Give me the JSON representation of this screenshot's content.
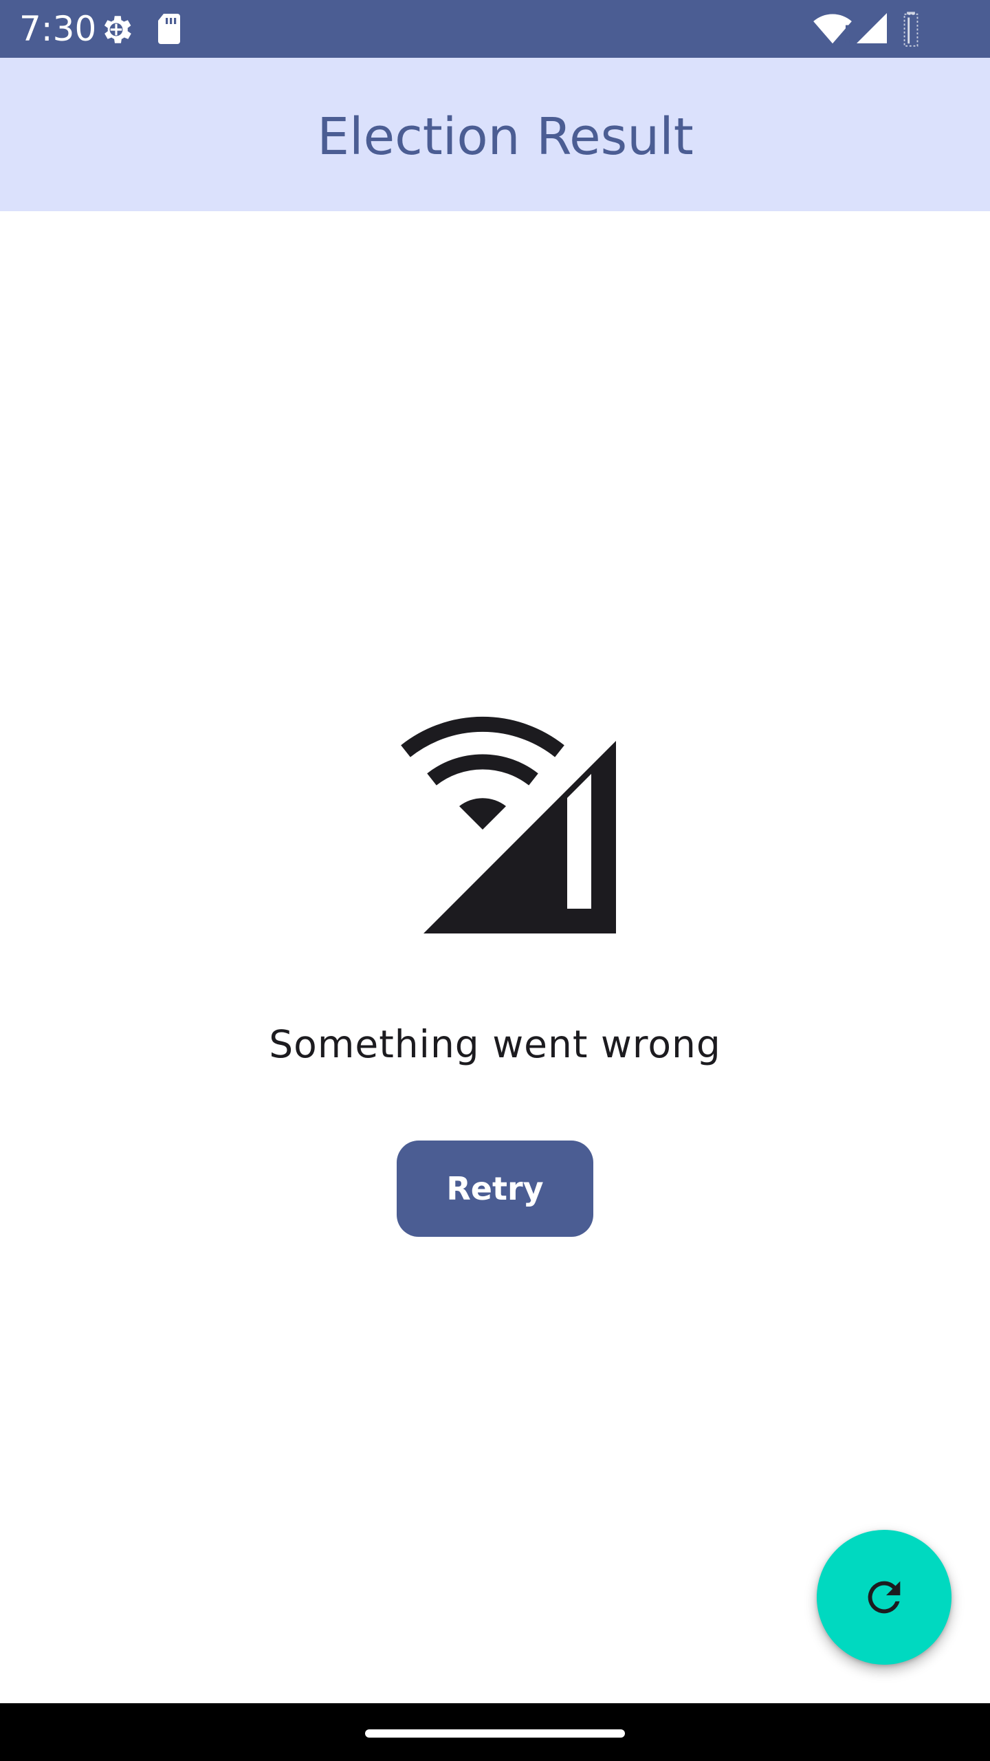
{
  "status_bar": {
    "time": "7:30",
    "icons": [
      "settings-gear-icon",
      "sd-card-icon",
      "wifi-alert-icon",
      "cell-signal-icon",
      "battery-icon"
    ],
    "background_color": "#4b5d93"
  },
  "app_bar": {
    "title": "Election Result",
    "background_color": "#dbe1fc",
    "title_color": "#4b5d93"
  },
  "error": {
    "icon": "network-off-icon",
    "message": "Something went wrong",
    "retry_label": "Retry"
  },
  "fab": {
    "icon": "refresh-icon",
    "color": "#00d9c0"
  },
  "accent_color": "#4b5d93"
}
